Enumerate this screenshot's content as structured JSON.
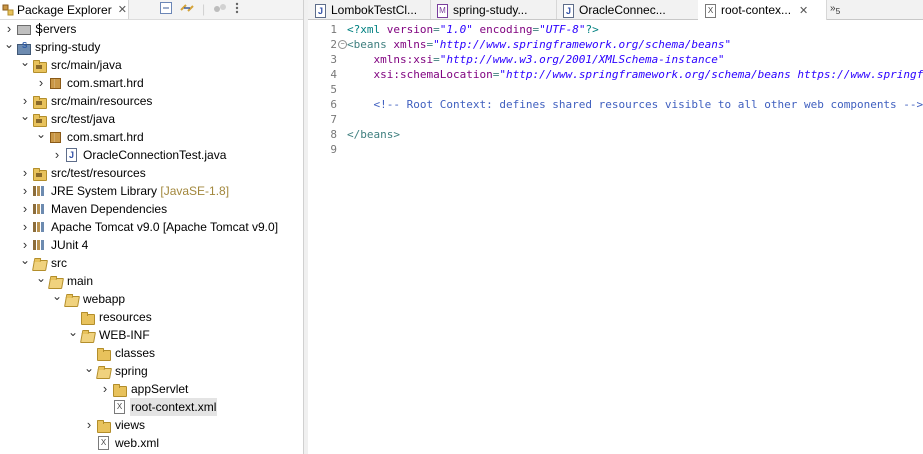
{
  "explorer": {
    "title": "Package Explorer",
    "tree": [
      {
        "label": "Servers",
        "twisty": "closed",
        "icon": "server-icon",
        "depth": 0
      },
      {
        "label": "spring-study",
        "twisty": "open",
        "icon": "project-icon",
        "depth": 0
      },
      {
        "label": "src/main/java",
        "twisty": "open",
        "icon": "source-folder-icon",
        "depth": 1
      },
      {
        "label": "com.smart.hrd",
        "twisty": "closed",
        "icon": "package-icon",
        "depth": 2
      },
      {
        "label": "src/main/resources",
        "twisty": "closed",
        "icon": "source-folder-icon",
        "depth": 1
      },
      {
        "label": "src/test/java",
        "twisty": "open",
        "icon": "source-folder-icon",
        "depth": 1
      },
      {
        "label": "com.smart.hrd",
        "twisty": "open",
        "icon": "package-icon",
        "depth": 2
      },
      {
        "label": "OracleConnectionTest.java",
        "twisty": "closed",
        "icon": "java-file-icon",
        "depth": 3
      },
      {
        "label": "src/test/resources",
        "twisty": "closed",
        "icon": "source-folder-icon",
        "depth": 1
      },
      {
        "label": "JRE System Library",
        "decoration": "[JavaSE-1.8]",
        "twisty": "closed",
        "icon": "library-icon",
        "depth": 1
      },
      {
        "label": "Maven Dependencies",
        "twisty": "closed",
        "icon": "library-icon",
        "depth": 1
      },
      {
        "label": "Apache Tomcat v9.0 [Apache Tomcat v9.0]",
        "twisty": "closed",
        "icon": "library-icon",
        "depth": 1
      },
      {
        "label": "JUnit 4",
        "twisty": "closed",
        "icon": "library-icon",
        "depth": 1
      },
      {
        "label": "src",
        "twisty": "open",
        "icon": "folder-icon",
        "depth": 1
      },
      {
        "label": "main",
        "twisty": "open",
        "icon": "folder-icon",
        "depth": 2
      },
      {
        "label": "webapp",
        "twisty": "open",
        "icon": "folder-icon",
        "depth": 3
      },
      {
        "label": "resources",
        "twisty": "none",
        "icon": "folder-icon",
        "depth": 4
      },
      {
        "label": "WEB-INF",
        "twisty": "open",
        "icon": "folder-icon",
        "depth": 4
      },
      {
        "label": "classes",
        "twisty": "none",
        "icon": "folder-icon",
        "depth": 5
      },
      {
        "label": "spring",
        "twisty": "open",
        "icon": "folder-icon",
        "depth": 5
      },
      {
        "label": "appServlet",
        "twisty": "closed",
        "icon": "folder-icon",
        "depth": 6
      },
      {
        "label": "root-context.xml",
        "twisty": "none",
        "icon": "xml-file-icon",
        "depth": 6,
        "selected": true
      },
      {
        "label": "views",
        "twisty": "closed",
        "icon": "folder-icon",
        "depth": 5
      },
      {
        "label": "web.xml",
        "twisty": "none",
        "icon": "xml-file-icon",
        "depth": 5
      }
    ]
  },
  "editor": {
    "tabs": [
      {
        "label": "LombokTestCl...",
        "icon": "java-file-icon"
      },
      {
        "label": "spring-study...",
        "icon": "maven-file-icon"
      },
      {
        "label": "OracleConnec...",
        "icon": "java-file-icon"
      },
      {
        "label": "root-contex...",
        "icon": "xml-file-icon",
        "active": true
      }
    ],
    "overflow_count": "5",
    "line_numbers": [
      "1",
      "2",
      "3",
      "4",
      "5",
      "6",
      "7",
      "8",
      "9"
    ],
    "lines": [
      [
        [
          "pi",
          "<?xml "
        ],
        [
          "attr",
          "version"
        ],
        [
          "tag",
          "="
        ],
        [
          "val",
          "\"1.0\""
        ],
        [
          "pi",
          " "
        ],
        [
          "attr",
          "encoding"
        ],
        [
          "tag",
          "="
        ],
        [
          "val",
          "\"UTF-8\""
        ],
        [
          "pi",
          "?>"
        ]
      ],
      [
        [
          "tag",
          "<beans "
        ],
        [
          "attr",
          "xmlns"
        ],
        [
          "tag",
          "="
        ],
        [
          "val",
          "\"http://www.springframework.org/schema/beans\""
        ]
      ],
      [
        [
          "tag",
          "    "
        ],
        [
          "attr",
          "xmlns:xsi"
        ],
        [
          "tag",
          "="
        ],
        [
          "val",
          "\"http://www.w3.org/2001/XMLSchema-instance\""
        ]
      ],
      [
        [
          "tag",
          "    "
        ],
        [
          "attr",
          "xsi:schemaLocation"
        ],
        [
          "tag",
          "="
        ],
        [
          "val",
          "\"http://www.springframework.org/schema/beans https://www.springframework.org/schema/beans/spring-beans.xsd\""
        ],
        [
          "tag",
          ">"
        ]
      ],
      [],
      [
        [
          "tag",
          "    "
        ],
        [
          "cmt",
          "<!-- Root Context: defines shared resources visible to all other web components -->"
        ]
      ],
      [],
      [
        [
          "tag",
          "</beans>"
        ]
      ],
      []
    ]
  }
}
